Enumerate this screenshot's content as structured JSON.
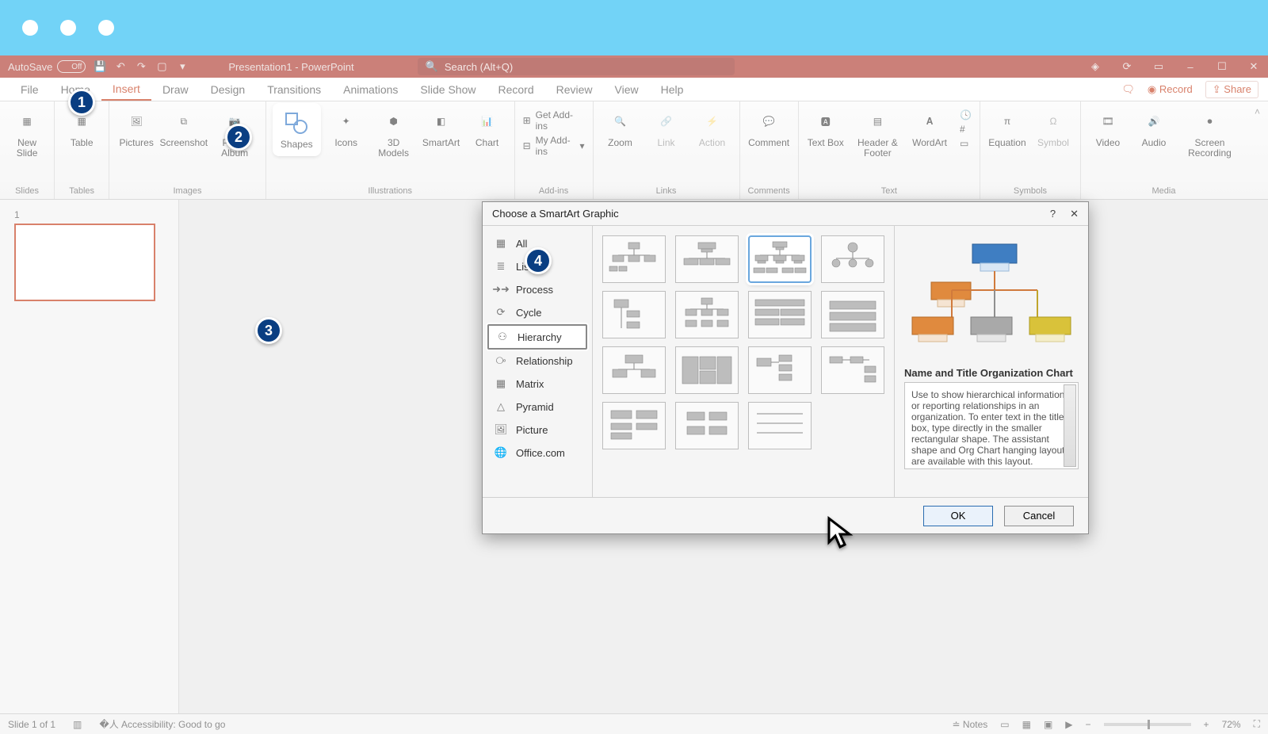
{
  "titlebar": {},
  "qat": {
    "autosave_label": "AutoSave",
    "autosave_state": "Off",
    "doc_title": "Presentation1 - PowerPoint",
    "search_placeholder": "Search (Alt+Q)"
  },
  "tabs": {
    "items": [
      "File",
      "Home",
      "Insert",
      "Draw",
      "Design",
      "Transitions",
      "Animations",
      "Slide Show",
      "Record",
      "Review",
      "View",
      "Help"
    ],
    "active_index": 2,
    "comments_label": "",
    "record_label": "Record",
    "share_label": "Share"
  },
  "ribbon": {
    "groups": {
      "slides": {
        "label": "Slides",
        "new_slide": "New\nSlide"
      },
      "tables": {
        "label": "Tables",
        "table": "Table"
      },
      "images": {
        "label": "Images",
        "pictures": "Pictures",
        "screenshot": "Screenshot",
        "photo_album": "Photo\nAlbum"
      },
      "illustrations": {
        "label": "Illustrations",
        "shapes": "Shapes",
        "icons": "Icons",
        "models": "3D\nModels",
        "smartart": "SmartArt",
        "chart": "Chart"
      },
      "addins": {
        "label": "Add-ins",
        "get": "Get Add-ins",
        "my": "My Add-ins"
      },
      "links": {
        "label": "Links",
        "zoom": "Zoom",
        "link": "Link",
        "action": "Action"
      },
      "comments": {
        "label": "Comments",
        "comment": "Comment"
      },
      "text": {
        "label": "Text",
        "textbox": "Text\nBox",
        "header": "Header\n& Footer",
        "wordart": "WordArt"
      },
      "symbols": {
        "label": "Symbols",
        "equation": "Equation",
        "symbol": "Symbol"
      },
      "media": {
        "label": "Media",
        "video": "Video",
        "audio": "Audio",
        "screenrec": "Screen\nRecording"
      }
    }
  },
  "thumbs": {
    "slide_number": "1"
  },
  "dialog": {
    "title": "Choose a SmartArt Graphic",
    "categories": [
      "All",
      "List",
      "Process",
      "Cycle",
      "Hierarchy",
      "Relationship",
      "Matrix",
      "Pyramid",
      "Picture",
      "Office.com"
    ],
    "selected_category_index": 4,
    "selected_layout_index": 2,
    "preview": {
      "title": "Name and Title Organization Chart",
      "description": "Use to show hierarchical information or reporting relationships in an organization. To enter text in the title box, type directly in the smaller rectangular shape. The assistant shape and Org Chart hanging layouts are available with this layout."
    },
    "ok": "OK",
    "cancel": "Cancel"
  },
  "status": {
    "slide": "Slide 1 of 1",
    "accessibility": "Accessibility: Good to go",
    "notes": "Notes",
    "zoom": "72%"
  },
  "badges": {
    "b1": "1",
    "b2": "2",
    "b3": "3",
    "b4": "4"
  }
}
